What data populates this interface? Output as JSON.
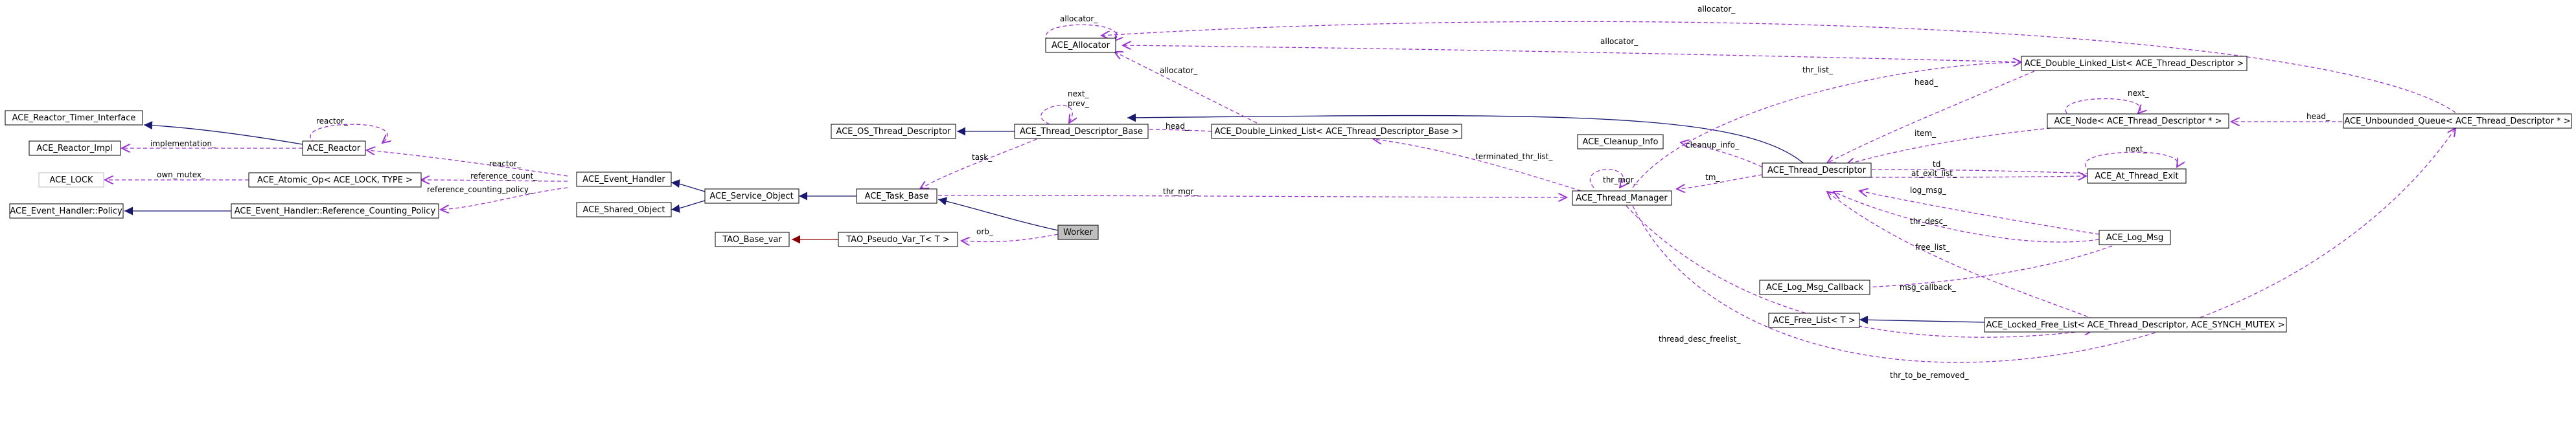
{
  "diagram": {
    "nodes": [
      {
        "id": "n_worker",
        "label": "Worker",
        "highlight": true
      },
      {
        "id": "n_tao_pseudo",
        "label": "TAO_Pseudo_Var_T< T >"
      },
      {
        "id": "n_tao_base",
        "label": "TAO_Base_var"
      },
      {
        "id": "n_task_base",
        "label": "ACE_Task_Base"
      },
      {
        "id": "n_service_object",
        "label": "ACE_Service_Object"
      },
      {
        "id": "n_shared_object",
        "label": "ACE_Shared_Object"
      },
      {
        "id": "n_event_handler",
        "label": "ACE_Event_Handler"
      },
      {
        "id": "n_eh_policy",
        "label": "ACE_Event_Handler::Policy"
      },
      {
        "id": "n_eh_rcp",
        "label": "ACE_Event_Handler::Reference_Counting_Policy"
      },
      {
        "id": "n_atomic_op",
        "label": "ACE_Atomic_Op< ACE_LOCK, TYPE >"
      },
      {
        "id": "n_ace_lock",
        "label": "ACE_LOCK",
        "dashed": true
      },
      {
        "id": "n_reactor",
        "label": "ACE_Reactor"
      },
      {
        "id": "n_reactor_impl",
        "label": "ACE_Reactor_Impl"
      },
      {
        "id": "n_reactor_timer",
        "label": "ACE_Reactor_Timer_Interface"
      },
      {
        "id": "n_os_td",
        "label": "ACE_OS_Thread_Descriptor"
      },
      {
        "id": "n_td_base",
        "label": "ACE_Thread_Descriptor_Base"
      },
      {
        "id": "n_allocator",
        "label": "ACE_Allocator"
      },
      {
        "id": "n_dll_tdb",
        "label": "ACE_Double_Linked_List< ACE_Thread_Descriptor_Base >"
      },
      {
        "id": "n_thread_manager",
        "label": "ACE_Thread_Manager"
      },
      {
        "id": "n_cleanup_info",
        "label": "ACE_Cleanup_Info"
      },
      {
        "id": "n_thread_descriptor",
        "label": "ACE_Thread_Descriptor"
      },
      {
        "id": "n_dll_td",
        "label": "ACE_Double_Linked_List< ACE_Thread_Descriptor >"
      },
      {
        "id": "n_node_td",
        "label": "ACE_Node< ACE_Thread_Descriptor * >"
      },
      {
        "id": "n_uq_td",
        "label": "ACE_Unbounded_Queue< ACE_Thread_Descriptor * >"
      },
      {
        "id": "n_at_thread_exit",
        "label": "ACE_At_Thread_Exit"
      },
      {
        "id": "n_log_msg",
        "label": "ACE_Log_Msg"
      },
      {
        "id": "n_log_msg_cb",
        "label": "ACE_Log_Msg_Callback"
      },
      {
        "id": "n_free_list",
        "label": "ACE_Free_List< T >"
      },
      {
        "id": "n_locked_free_list",
        "label": "ACE_Locked_Free_List< ACE_Thread_Descriptor, ACE_SYNCH_MUTEX >"
      }
    ],
    "edge_labels": [
      {
        "id": "e_orb",
        "text": "orb_"
      },
      {
        "id": "e_thr_mgr_worker",
        "text": "thr_mgr_"
      },
      {
        "id": "e_task",
        "text": "task_"
      },
      {
        "id": "e_next_prev",
        "text": "next_\nprev_"
      },
      {
        "id": "e_reactor_eh",
        "text": "reactor_"
      },
      {
        "id": "e_reactor_self",
        "text": "reactor_"
      },
      {
        "id": "e_implementation",
        "text": "implementation_"
      },
      {
        "id": "e_own_mutex",
        "text": "own_mutex_"
      },
      {
        "id": "e_reference_count",
        "text": "reference_count_"
      },
      {
        "id": "e_reference_counting_policy",
        "text": "reference_counting_policy_"
      },
      {
        "id": "e_allocator_self",
        "text": "allocator_"
      },
      {
        "id": "e_allocator_dll",
        "text": "allocator_"
      },
      {
        "id": "e_allocator_dll_td",
        "text": "allocator_"
      },
      {
        "id": "e_allocator_uq",
        "text": "allocator_"
      },
      {
        "id": "e_head_dll_tdb",
        "text": "head_"
      },
      {
        "id": "e_terminated",
        "text": "terminated_thr_list_"
      },
      {
        "id": "e_thr_list",
        "text": "thr_list_"
      },
      {
        "id": "e_thr_mgr_self",
        "text": "thr_mgr_"
      },
      {
        "id": "e_cleanup_info",
        "text": "cleanup_info_"
      },
      {
        "id": "e_tm",
        "text": "tm_"
      },
      {
        "id": "e_head_dll_td",
        "text": "head_"
      },
      {
        "id": "e_item",
        "text": "item_"
      },
      {
        "id": "e_next_node",
        "text": "next_"
      },
      {
        "id": "e_head_uq",
        "text": "head_"
      },
      {
        "id": "e_next_ate",
        "text": "next_"
      },
      {
        "id": "e_td",
        "text": "td_"
      },
      {
        "id": "e_at_exit_list",
        "text": "at_exit_list_"
      },
      {
        "id": "e_log_msg",
        "text": "log_msg_"
      },
      {
        "id": "e_thr_desc",
        "text": "thr_desc_"
      },
      {
        "id": "e_free_list",
        "text": "free_list_"
      },
      {
        "id": "e_msg_callback",
        "text": "msg_callback_"
      },
      {
        "id": "e_thread_desc_freelist",
        "text": "thread_desc_freelist_"
      },
      {
        "id": "e_thr_to_be_removed",
        "text": "thr_to_be_removed_"
      }
    ],
    "colors": {
      "inheritance": "#191970",
      "usage": "#9a32cd",
      "template": "#8b0000",
      "highlight_fill": "#bfbfbf",
      "node_border": "#000000",
      "dashed_node_border": "#bfbfbf"
    }
  }
}
